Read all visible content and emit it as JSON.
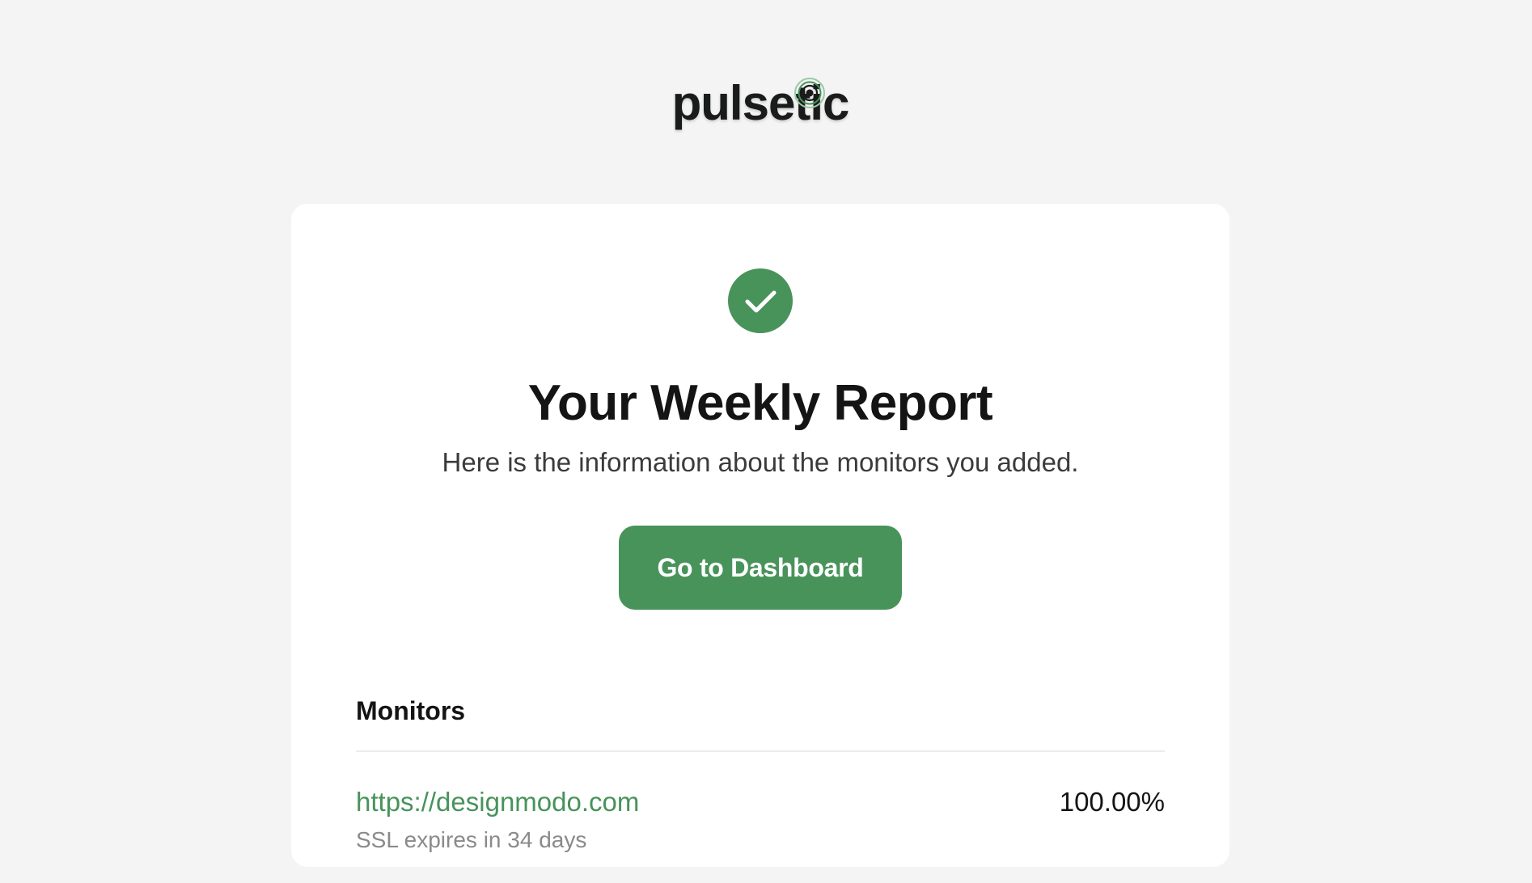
{
  "brand": {
    "logo_text": "pulsetic",
    "accent_color": "#48935a"
  },
  "report": {
    "status_icon": "check-circle-icon",
    "title": "Your Weekly Report",
    "subtitle": "Here is the information about the monitors you added.",
    "dashboard_button_label": "Go to Dashboard"
  },
  "monitors": {
    "heading": "Monitors",
    "items": [
      {
        "url": "https://designmodo.com",
        "uptime": "100.00%",
        "subtext": "SSL expires in 34 days"
      }
    ]
  }
}
